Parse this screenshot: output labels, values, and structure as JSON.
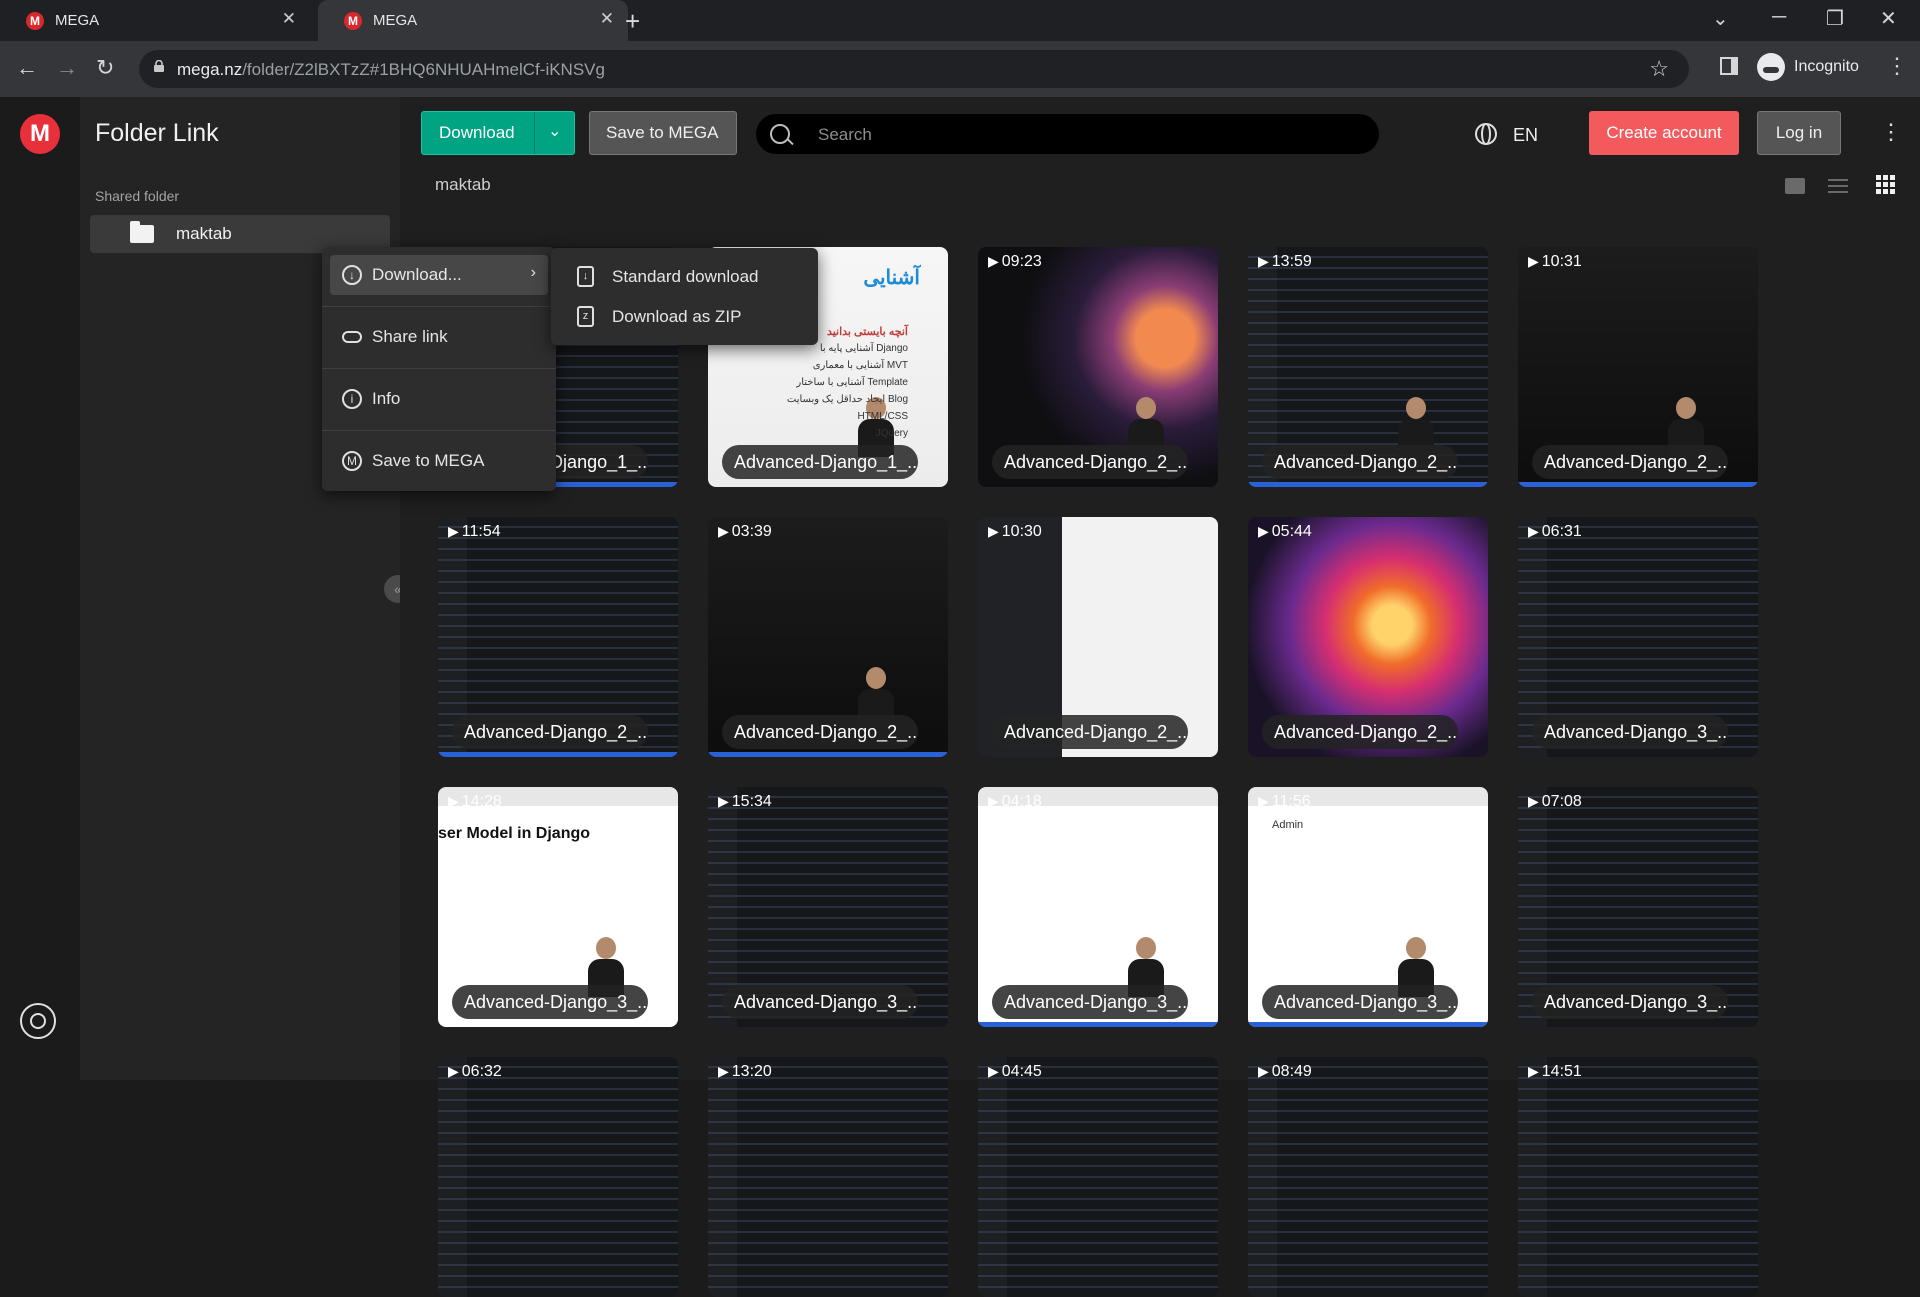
{
  "browser": {
    "tabs": [
      {
        "title": "MEGA",
        "favicon": "M"
      },
      {
        "title": "MEGA",
        "favicon": "M"
      }
    ],
    "url_host": "mega.nz",
    "url_path": "/folder/Z2lBXTzZ#1BHQ6NHUAHmelCf-iKNSVg",
    "profile_label": "Incognito"
  },
  "app": {
    "logo": "M",
    "sidebar": {
      "title": "Folder Link",
      "section_label": "Shared folder",
      "tree": [
        {
          "label": "maktab"
        }
      ]
    },
    "toolbar": {
      "download_label": "Download",
      "save_label": "Save to MEGA",
      "search_placeholder": "Search",
      "language": "EN",
      "create_account_label": "Create account",
      "login_label": "Log in"
    },
    "breadcrumb": "maktab",
    "context_menu": {
      "items": [
        {
          "label": "Download...",
          "icon": "download-circle-icon"
        },
        {
          "label": "Share link",
          "icon": "link-icon"
        },
        {
          "label": "Info",
          "icon": "info-icon"
        },
        {
          "label": "Save to MEGA",
          "icon": "mega-icon"
        }
      ],
      "submenu": [
        {
          "label": "Standard download",
          "icon": "download-file-icon"
        },
        {
          "label": "Download as ZIP",
          "icon": "zip-file-icon"
        }
      ]
    },
    "files": [
      {
        "duration": "",
        "name": "Advanced-Django_1_..."
      },
      {
        "duration": "",
        "name": "Advanced-Django_1_..."
      },
      {
        "duration": "09:23",
        "name": "Advanced-Django_2_..."
      },
      {
        "duration": "13:59",
        "name": "Advanced-Django_2_..."
      },
      {
        "duration": "10:31",
        "name": "Advanced-Django_2_..."
      },
      {
        "duration": "11:54",
        "name": "Advanced-Django_2_..."
      },
      {
        "duration": "03:39",
        "name": "Advanced-Django_2_..."
      },
      {
        "duration": "10:30",
        "name": "Advanced-Django_2_..."
      },
      {
        "duration": "05:44",
        "name": "Advanced-Django_2_..."
      },
      {
        "duration": "06:31",
        "name": "Advanced-Django_3_..."
      },
      {
        "duration": "14:28",
        "name": "Advanced-Django_3_..."
      },
      {
        "duration": "15:34",
        "name": "Advanced-Django_3_..."
      },
      {
        "duration": "04:18",
        "name": "Advanced-Django_3_..."
      },
      {
        "duration": "11:56",
        "name": "Advanced-Django_3_..."
      },
      {
        "duration": "07:08",
        "name": "Advanced-Django_3_..."
      },
      {
        "duration": "06:32",
        "name": ""
      },
      {
        "duration": "13:20",
        "name": ""
      },
      {
        "duration": "04:45",
        "name": ""
      },
      {
        "duration": "08:49",
        "name": ""
      },
      {
        "duration": "14:51",
        "name": ""
      }
    ],
    "thumb_texts": {
      "card1_heading": "آشنایی",
      "card1_subheading": "آنچه بایستی بدانید",
      "card1_bullets": [
        "Django آشنایی پایه با",
        "MVT آشنایی با معماری",
        "Template آشنایی با ساختار",
        "Blog ایجاد حداقل یک وبسایت",
        "HTML/CSS",
        "JQuery"
      ],
      "card10_heading": "ser Model in Django",
      "card13_admin": "Admin"
    },
    "accent_color": "#00a382",
    "create_account_color": "#f35a5e"
  }
}
